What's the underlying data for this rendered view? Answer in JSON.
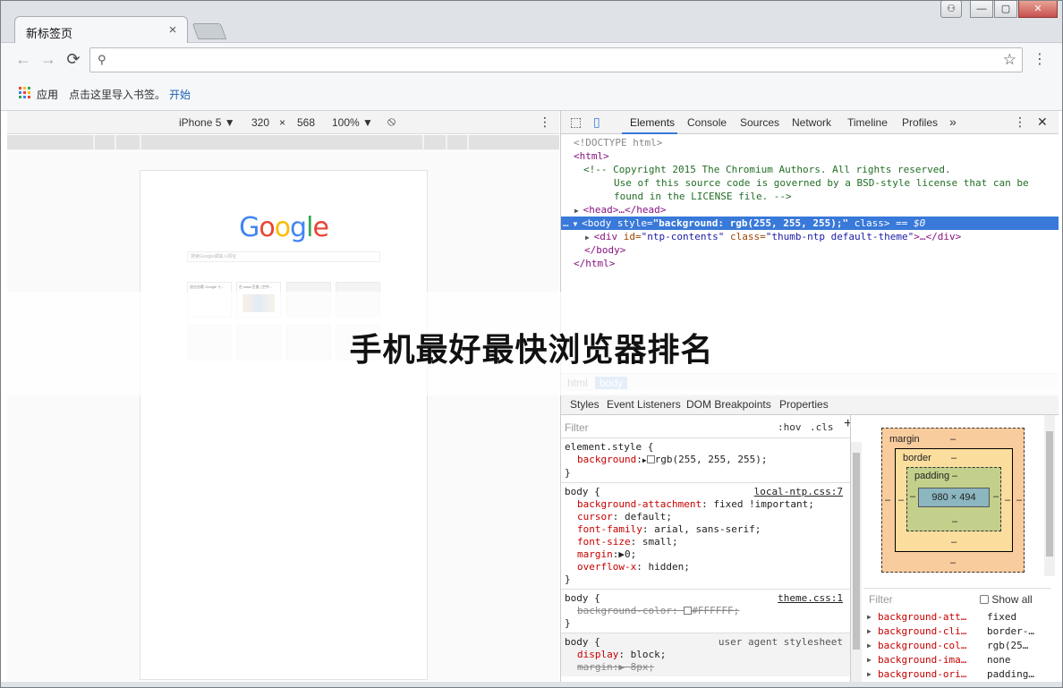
{
  "tab": {
    "title": "新标签页",
    "close": "×"
  },
  "window": {
    "user": "⚇",
    "minimize": "—",
    "maximize": "▢",
    "close": "✕"
  },
  "toolbar": {
    "back": "←",
    "forward": "→",
    "reload": "⟳",
    "search_icon": "⚲",
    "star": "☆",
    "menu": "⋮"
  },
  "bookmarks": {
    "apps": "应用",
    "hint": "点击这里导入书签。",
    "start": "开始"
  },
  "device": {
    "model": "iPhone 5 ▼",
    "width": "320",
    "times": "×",
    "height": "568",
    "zoom": "100% ▼",
    "rotate": "⃠",
    "menu": "⋮"
  },
  "page": {
    "logo_letters": [
      "G",
      "o",
      "o",
      "g",
      "l",
      "e"
    ],
    "logo_colors": [
      "#4285f4",
      "#ea4335",
      "#fbbc05",
      "#4285f4",
      "#34a853",
      "#ea4335"
    ],
    "search_placeholder": "搜索Google或输入网址",
    "tile1": "进击谷歌 Google 十...",
    "tile2": "在 www.百度 | 空中..."
  },
  "devtools": {
    "tabs": [
      "Elements",
      "Console",
      "Sources",
      "Network",
      "Timeline",
      "Profiles"
    ],
    "more": "»",
    "menu": "⋮",
    "close": "✕",
    "code": {
      "l1": "<!DOCTYPE html>",
      "l2": "<html>",
      "l3": "<!-- Copyright 2015 The Chromium Authors. All rights reserved.",
      "l4": "Use of this source code is governed by a BSD-style license that can be",
      "l5": "found in the LICENSE file. -->",
      "l6_tag": "<head>",
      "l6_rest": "…</head>",
      "l7_prefix": "…",
      "l7_tag": "<body",
      "l7_attr": " style=",
      "l7_val": "\"background: rgb(255, 255, 255);\"",
      "l7_attr2": " class",
      "l7_tail": "> == $0",
      "l8_tag": "<div",
      "l8_a1": " id=",
      "l8_v1": "\"ntp-contents\"",
      "l8_a2": " class=",
      "l8_v2": "\"thumb-ntp default-theme\"",
      "l8_tail": ">…</div>",
      "l9": "</body>",
      "l10": "</html>"
    },
    "crumbs": [
      "html",
      "body"
    ],
    "subtabs": [
      "Styles",
      "Event Listeners",
      "DOM Breakpoints",
      "Properties"
    ],
    "filter": "Filter",
    "hov": ":hov",
    "cls": ".cls",
    "plus": "+",
    "rules": {
      "element_style": "element.style {",
      "es_prop": "background",
      "es_val": "rgb(255, 255, 255);",
      "body1_sel": "body {",
      "body1_src": "local-ntp.css:7",
      "body1_props": [
        [
          "background-attachment",
          ": fixed !important;"
        ],
        [
          "cursor",
          ": default;"
        ],
        [
          "font-family",
          ": arial, sans-serif;"
        ],
        [
          "font-size",
          ": small;"
        ],
        [
          "margin",
          ":▶0;"
        ],
        [
          "overflow-x",
          ": hidden;"
        ]
      ],
      "body2_src": "theme.css:1",
      "body2_prop": "background-color: ",
      "body2_val": "#FFFFFF;",
      "body3_src": "user agent stylesheet",
      "body3_p1": "display",
      "body3_v1": ": block;",
      "body3_p2": "margin:▶ 8px;",
      "close": "}"
    },
    "boxmodel": {
      "margin": "margin",
      "border": "border",
      "padding": "padding",
      "content": "980 × 494",
      "dash": "–"
    },
    "computed_filter": "Filter",
    "show_all": "Show all",
    "computed": [
      [
        "background-att…",
        "fixed"
      ],
      [
        "background-cli…",
        "border-…"
      ],
      [
        "background-col…",
        "rgb(25…"
      ],
      [
        "background-ima…",
        "none"
      ],
      [
        "background-ori…",
        "padding…"
      ]
    ]
  },
  "banner": {
    "text": "手机最好最快浏览器排名"
  }
}
